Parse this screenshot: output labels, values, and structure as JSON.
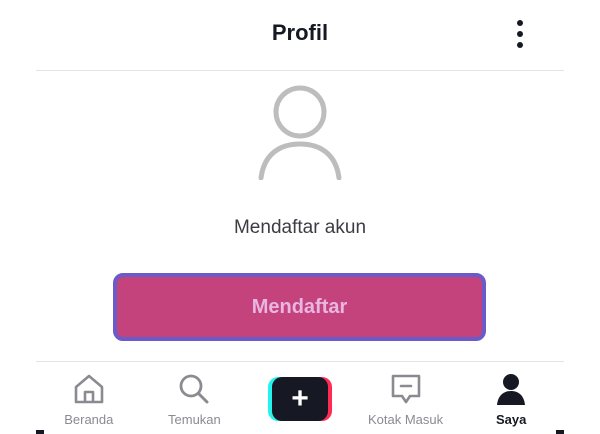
{
  "header": {
    "title": "Profil",
    "more_icon": "more-vertical-icon"
  },
  "profile": {
    "avatar_icon": "user-placeholder-icon",
    "prompt": "Mendaftar akun",
    "signup_label": "Mendaftar"
  },
  "colors": {
    "accent": "#c5437d",
    "button_border": "#6a5bc9",
    "button_text": "#e9b6e2",
    "text_dark": "#161823",
    "text_muted": "#8a8b91"
  },
  "tabbar": {
    "items": [
      {
        "label": "Beranda",
        "icon": "home-icon",
        "active": false
      },
      {
        "label": "Temukan",
        "icon": "search-icon",
        "active": false
      },
      {
        "label": "",
        "icon": "create-plus-icon",
        "active": false
      },
      {
        "label": "Kotak Masuk",
        "icon": "inbox-icon",
        "active": false
      },
      {
        "label": "Saya",
        "icon": "profile-icon",
        "active": true
      }
    ]
  }
}
